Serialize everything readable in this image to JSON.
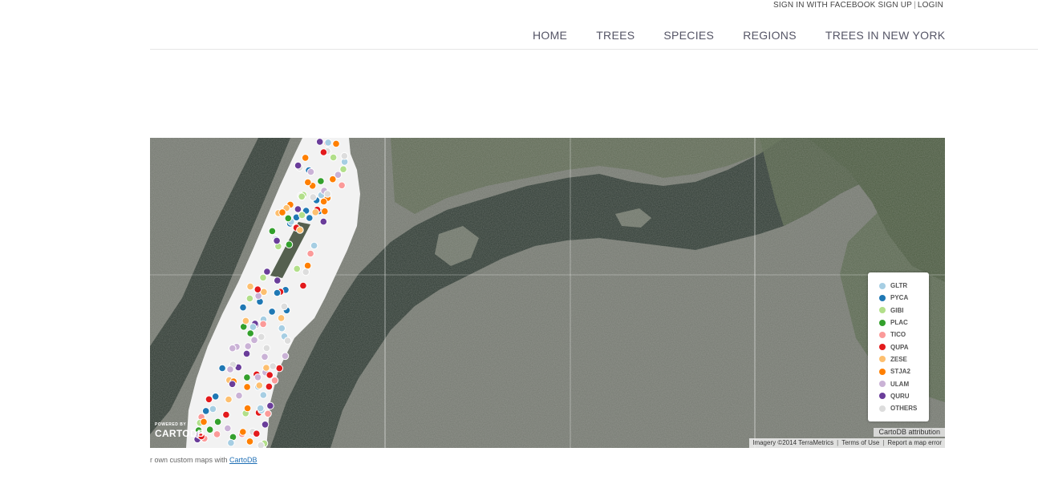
{
  "header": {
    "signin_facebook": "SIGN IN WITH FACEBOOK",
    "signup": "SIGN UP",
    "separator": "|",
    "login": "LOGIN"
  },
  "nav": {
    "items": [
      "HOME",
      "TREES",
      "SPECIES",
      "REGIONS",
      "TREES IN NEW YORK"
    ]
  },
  "map": {
    "legend": [
      {
        "label": "GLTR",
        "color": "#a6cee3"
      },
      {
        "label": "PYCA",
        "color": "#1f78b4"
      },
      {
        "label": "GIBI",
        "color": "#b2df8a"
      },
      {
        "label": "PLAC",
        "color": "#33a02c"
      },
      {
        "label": "TICO",
        "color": "#fb9a99"
      },
      {
        "label": "QUPA",
        "color": "#e31a1c"
      },
      {
        "label": "ZESE",
        "color": "#fdbf6f"
      },
      {
        "label": "STJA2",
        "color": "#ff7f00"
      },
      {
        "label": "ULAM",
        "color": "#cab2d6"
      },
      {
        "label": "QURU",
        "color": "#6a3d9a"
      },
      {
        "label": "OTHERS",
        "color": "#dddddd"
      }
    ],
    "cartodb_attribution": "CartoDB attribution",
    "imagery": "Imagery ©2014 TerraMetrics",
    "terms": "Terms of Use",
    "report": "Report a map error",
    "logo_powered": "POWERED BY",
    "logo_name": "CARTODB"
  },
  "footer": {
    "text": "r own custom maps with",
    "link": "CartoDB"
  }
}
